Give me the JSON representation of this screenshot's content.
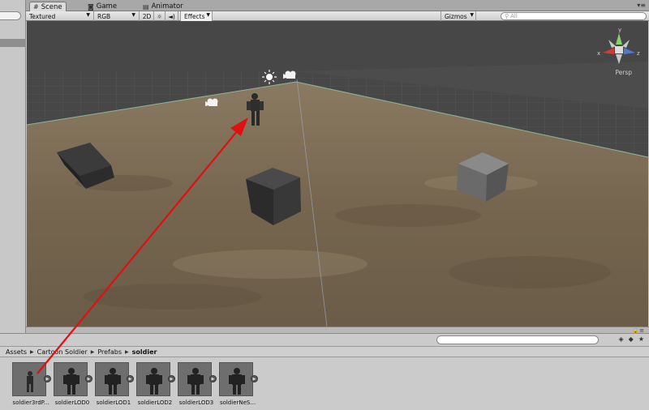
{
  "tabs": [
    {
      "label": "Scene",
      "icon": "scene-icon"
    },
    {
      "label": "Game",
      "icon": "game-icon"
    },
    {
      "label": "Animator",
      "icon": "animator-icon"
    }
  ],
  "toolbar": {
    "draw_mode": "Textured",
    "render_mode": "RGB",
    "btn_2d": "2D",
    "effects": "Effects",
    "gizmos": "Gizmos",
    "search_placeholder": "All"
  },
  "scene": {
    "projection_label": "Persp",
    "gizmo_axes": {
      "x": "x",
      "y": "y",
      "z": "z"
    },
    "colors": {
      "ground": "#7a6a55",
      "sky": "#4a4a4a",
      "grid": "#6a6a6a",
      "arrow": "#e01010"
    }
  },
  "breadcrumb": [
    "Assets",
    "Cartoon Soldier",
    "Prefabs",
    "soldier"
  ],
  "assets": [
    {
      "label": "soldier3rdP..."
    },
    {
      "label": "soldierLOD0"
    },
    {
      "label": "soldierLOD1"
    },
    {
      "label": "soldierLOD2"
    },
    {
      "label": "soldierLOD3"
    },
    {
      "label": "soldierNeS..."
    }
  ]
}
